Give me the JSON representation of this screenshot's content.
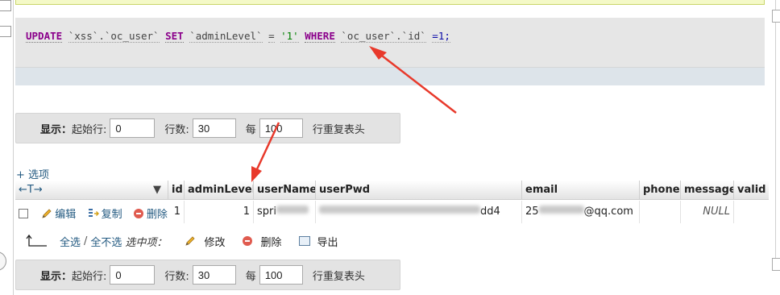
{
  "sql": {
    "kw_update": "UPDATE",
    "table_ref": "`xss`.`oc_user`",
    "kw_set": "SET",
    "col": "`adminLevel`",
    "eq1": "=",
    "val": "'1'",
    "kw_where": "WHERE",
    "where_col": "`oc_user`.`id`",
    "eq2": "=1;"
  },
  "nav": {
    "show_label": "显示：",
    "start_label": "起始行:",
    "start_value": "0",
    "rows_label": "行数:",
    "rows_value": "30",
    "per_label": "每",
    "per_value": "100",
    "repeat_label": "行重复表头"
  },
  "options_link": "+ 选项",
  "table": {
    "arrows_label": "←T→",
    "headers": [
      "id",
      "adminLevel",
      "userName",
      "userPwd",
      "email",
      "phone",
      "message",
      "valid"
    ],
    "row": {
      "edit": "编辑",
      "copy": "复制",
      "delete": "删除",
      "id": "1",
      "adminLevel": "1",
      "userName_visible": "spri",
      "userPwd_start": "",
      "userPwd_end": "dd4",
      "email_start": "25",
      "email_end": "@qq.com",
      "phone": "",
      "message": "NULL"
    }
  },
  "bulk": {
    "select_all": "全选",
    "slash": "/",
    "deselect_all": "全不选",
    "with_selected": "选中项：",
    "modify": "修改",
    "delete": "删除",
    "export": "导出"
  },
  "colors": {
    "keyword": "#8b008b",
    "link": "#235a81",
    "annotation_arrow": "#e8392b"
  }
}
